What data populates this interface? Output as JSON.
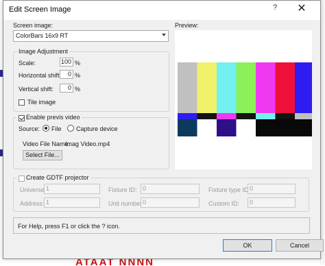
{
  "background": {
    "red_text": "ATAAT NNNN"
  },
  "dialog": {
    "title": "Edit Screen Image",
    "help_glyph": "?",
    "close_glyph": "✕"
  },
  "screen_image": {
    "label": "Screen image:",
    "selected": "ColorBars 16x9 RT"
  },
  "image_adjustment": {
    "legend": "Image Adjustment",
    "scale_label": "Scale:",
    "scale_value": "100",
    "scale_unit": "%",
    "hshift_label": "Horizontal shift:",
    "hshift_value": "0",
    "hshift_unit": "%",
    "vshift_label": "Vertical shift:",
    "vshift_value": "0",
    "vshift_unit": "%",
    "tile_label": "Tile image",
    "tile_checked": false
  },
  "previs": {
    "enable_label": "Enable previs video",
    "enable_checked": true,
    "source_label": "Source:",
    "file_label": "File",
    "capture_label": "Capture device",
    "source_selected": "File",
    "video_file_label": "Video File Name:",
    "video_file_value": "Imag Video.mp4",
    "select_file_label": "Select File..."
  },
  "gdtf": {
    "create_label": "Create GDTF projector",
    "create_checked": false,
    "universe_label": "Universe:",
    "universe_value": "1",
    "address_label": "Address:",
    "address_value": "1",
    "fixture_id_label": "Fixture ID:",
    "fixture_id_value": "0",
    "unit_number_label": "Unit number:",
    "unit_number_value": "0",
    "fixture_type_id_label": "Fixture type ID:",
    "fixture_type_id_value": "0",
    "custom_id_label": "Custom ID:",
    "custom_id_value": "0"
  },
  "preview": {
    "label": "Preview:",
    "top_bar_colors": [
      "#c0c0c0",
      "#f1f06a",
      "#71f1f0",
      "#8cf05a",
      "#f038f0",
      "#f0103a",
      "#2f1cf0"
    ],
    "middle_bar_colors": [
      "#2f1cf0",
      "#141414",
      "#f038f0",
      "#141414",
      "#71f1f0",
      "#141414",
      "#c0c0c0"
    ],
    "bottom_bar_colors": [
      "#0c3a5e",
      "#ffffff",
      "#2d0f8a",
      "#ffffff",
      "#090909",
      "#090909",
      "#090909"
    ]
  },
  "status": {
    "text": "For Help, press F1 or click the ? icon."
  },
  "buttons": {
    "ok": "OK",
    "cancel": "Cancel"
  }
}
